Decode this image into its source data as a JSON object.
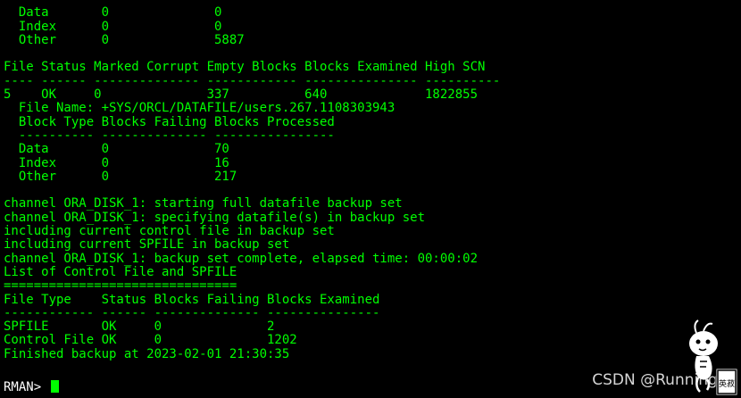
{
  "terminal": {
    "lines": [
      "  ---------- -------------- ----------------",
      "  Data       0              0",
      "  Index      0              0",
      "  Other      0              5887",
      "",
      "File Status Marked Corrupt Empty Blocks Blocks Examined High SCN",
      "---- ------ -------------- ------------ --------------- ----------",
      "5    OK     0              337          640             1822855",
      "  File Name: +SYS/ORCL/DATAFILE/users.267.1108303943",
      "  Block Type Blocks Failing Blocks Processed",
      "  ---------- -------------- ----------------",
      "  Data       0              70",
      "  Index      0              16",
      "  Other      0              217",
      "",
      "channel ORA_DISK_1: starting full datafile backup set",
      "channel ORA_DISK_1: specifying datafile(s) in backup set",
      "including current control file in backup set",
      "including current SPFILE in backup set",
      "channel ORA_DISK_1: backup set complete, elapsed time: 00:00:02",
      "List of Control File and SPFILE",
      "===============================",
      "File Type    Status Blocks Failing Blocks Examined",
      "------------ ------ -------------- ---------------",
      "SPFILE       OK     0              2",
      "Control File OK     0              1202",
      "Finished backup at 2023-02-01 21:30:35",
      ""
    ],
    "prompt": "RMAN> "
  },
  "watermark": {
    "text": "CSDN @Running S",
    "stamp_text": "英菽"
  },
  "colors": {
    "background": "#000000",
    "output_text": "#00ff00",
    "prompt_text": "#ffffff",
    "cursor": "#00ff00",
    "watermark_text": "#d6d6d6"
  }
}
